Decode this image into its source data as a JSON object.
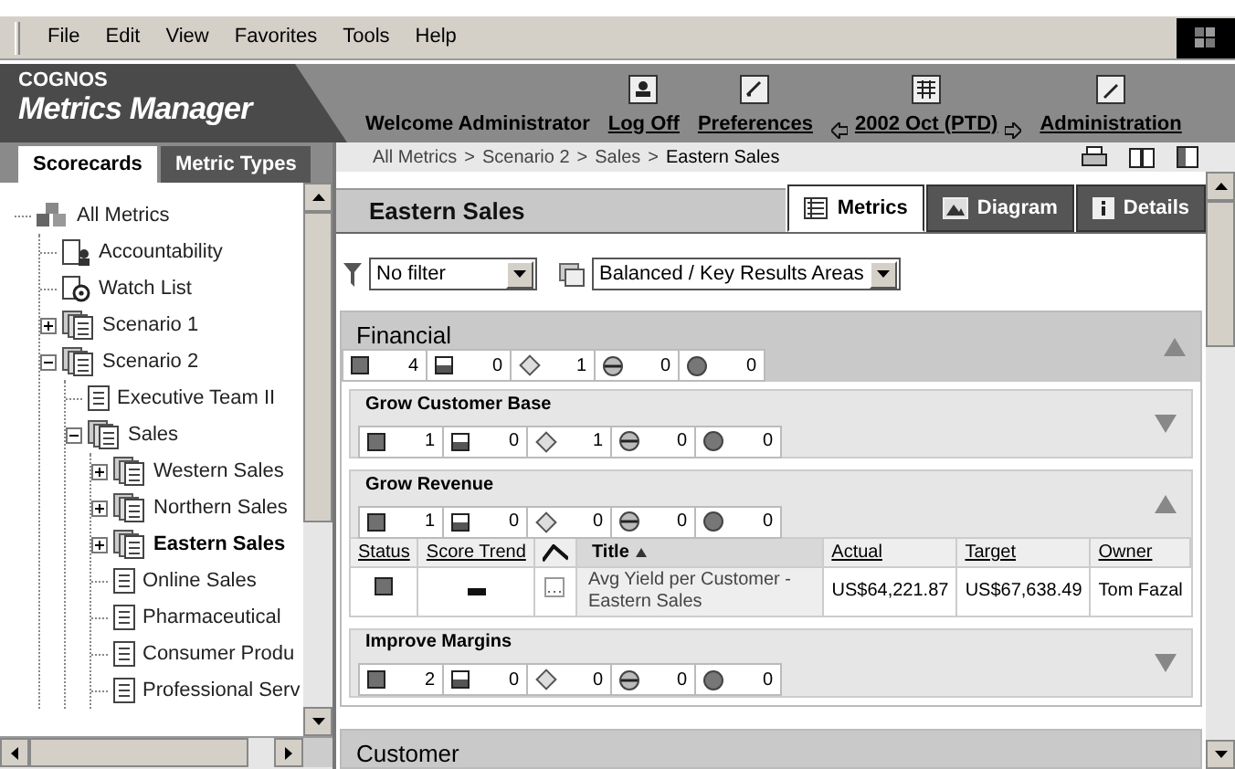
{
  "menu": [
    "File",
    "Edit",
    "View",
    "Favorites",
    "Tools",
    "Help"
  ],
  "header": {
    "brand": "COGNOS",
    "product": "Metrics Manager",
    "welcome": "Welcome Administrator",
    "links": [
      {
        "label": "Log Off",
        "kind": "logoff"
      },
      {
        "label": "Preferences",
        "kind": "prefs"
      },
      {
        "label": "2002 Oct (PTD)",
        "kind": "period"
      },
      {
        "label": "Administration",
        "kind": "admin"
      }
    ]
  },
  "left_tabs": [
    {
      "label": "Scorecards",
      "selected": true
    },
    {
      "label": "Metric Types",
      "selected": false
    }
  ],
  "tree": [
    {
      "label": "All Metrics",
      "kind": "root",
      "selected": false,
      "children": [
        {
          "label": "Accountability",
          "kind": "accountability",
          "selected": false
        },
        {
          "label": "Watch List",
          "kind": "watch",
          "selected": false
        },
        {
          "label": "Scenario 1",
          "kind": "group",
          "expanded": false,
          "selected": false
        },
        {
          "label": "Scenario 2",
          "kind": "group",
          "expanded": true,
          "selected": false,
          "children": [
            {
              "label": "Executive Team II",
              "kind": "scorecard",
              "selected": false
            },
            {
              "label": "Sales",
              "kind": "group",
              "expanded": true,
              "selected": false,
              "children": [
                {
                  "label": "Western Sales",
                  "kind": "group",
                  "expanded": false,
                  "selected": false
                },
                {
                  "label": "Northern Sales",
                  "kind": "group",
                  "expanded": false,
                  "selected": false
                },
                {
                  "label": "Eastern Sales",
                  "kind": "group",
                  "expanded": false,
                  "selected": true
                },
                {
                  "label": "Online Sales",
                  "kind": "scorecard",
                  "selected": false
                },
                {
                  "label": "Pharmaceutical",
                  "kind": "scorecard",
                  "selected": false
                },
                {
                  "label": "Consumer Produ",
                  "kind": "scorecard",
                  "selected": false
                },
                {
                  "label": "Professional Serv",
                  "kind": "scorecard",
                  "selected": false
                }
              ]
            }
          ]
        }
      ]
    }
  ],
  "breadcrumb": {
    "separator": ">",
    "items": [
      "All Metrics",
      "Scenario 2",
      "Sales",
      "Eastern Sales"
    ]
  },
  "page_title": "Eastern Sales",
  "content_tabs": [
    {
      "label": "Metrics",
      "kind": "metrics",
      "selected": true
    },
    {
      "label": "Diagram",
      "kind": "diagram",
      "selected": false
    },
    {
      "label": "Details",
      "kind": "details",
      "selected": false
    }
  ],
  "filters": {
    "filter": "No filter",
    "view": "Balanced / Key Results Areas"
  },
  "sections": [
    {
      "title": "Financial",
      "expanded": true,
      "counts": [
        {
          "kind": "square",
          "count": "4"
        },
        {
          "kind": "half",
          "count": "0"
        },
        {
          "kind": "diamond",
          "count": "1"
        },
        {
          "kind": "halfcircle",
          "count": "0"
        },
        {
          "kind": "circle",
          "count": "0"
        }
      ],
      "groups": [
        {
          "title": "Grow Customer Base",
          "expanded": false,
          "counts": [
            {
              "kind": "square",
              "count": "1"
            },
            {
              "kind": "half",
              "count": "0"
            },
            {
              "kind": "diamond",
              "count": "1"
            },
            {
              "kind": "halfcircle",
              "count": "0"
            },
            {
              "kind": "circle",
              "count": "0"
            }
          ]
        },
        {
          "title": "Grow Revenue",
          "expanded": true,
          "counts": [
            {
              "kind": "square",
              "count": "1"
            },
            {
              "kind": "half",
              "count": "0"
            },
            {
              "kind": "diamond",
              "count": "0"
            },
            {
              "kind": "halfcircle",
              "count": "0"
            },
            {
              "kind": "circle",
              "count": "0"
            }
          ],
          "table": {
            "columns": [
              {
                "label": "Status",
                "kind": "link"
              },
              {
                "label": "Score Trend",
                "kind": "link"
              },
              {
                "kind": "trend"
              },
              {
                "label": "Title",
                "kind": "sorted"
              },
              {
                "label": "Actual",
                "kind": "link"
              },
              {
                "label": "Target",
                "kind": "link"
              },
              {
                "label": "Owner",
                "kind": "link"
              }
            ],
            "rows": [
              {
                "status": {
                  "kind": "square"
                },
                "trend": {
                  "kind": "flat"
                },
                "title": "Avg Yield per Customer - Eastern Sales",
                "actual": "US$64,221.87",
                "target": "US$67,638.49",
                "owner": "Tom Fazal"
              }
            ]
          }
        },
        {
          "title": "Improve Margins",
          "expanded": false,
          "counts": [
            {
              "kind": "square",
              "count": "2"
            },
            {
              "kind": "half",
              "count": "0"
            },
            {
              "kind": "diamond",
              "count": "0"
            },
            {
              "kind": "halfcircle",
              "count": "0"
            },
            {
              "kind": "circle",
              "count": "0"
            }
          ]
        }
      ]
    },
    {
      "title": "Customer"
    }
  ]
}
